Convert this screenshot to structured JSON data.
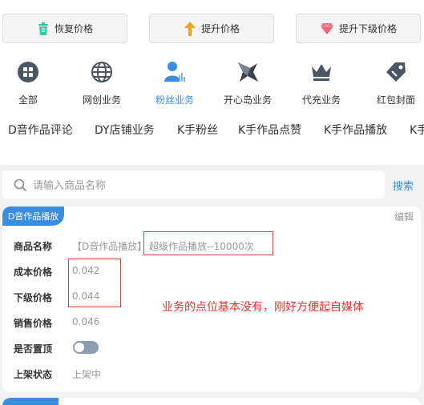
{
  "actions": [
    {
      "label": "恢复价格",
      "icon": "recycle-bin-icon"
    },
    {
      "label": "提升价格",
      "icon": "arrow-up-icon"
    },
    {
      "label": "提升下级价格",
      "icon": "diamond-icon"
    }
  ],
  "categories": [
    {
      "label": "全部",
      "icon": "grid-icon",
      "active": false
    },
    {
      "label": "网创业务",
      "icon": "globe-icon",
      "active": false
    },
    {
      "label": "粉丝业务",
      "icon": "user-chart-icon",
      "active": true
    },
    {
      "label": "开心岛业务",
      "icon": "star-icon",
      "active": false
    },
    {
      "label": "代充业务",
      "icon": "crown-icon",
      "active": false
    },
    {
      "label": "红包封面",
      "icon": "tag-icon",
      "active": false
    }
  ],
  "subtabs": [
    "D音作品评论",
    "DY店铺业务",
    "K手粉丝",
    "K手作品点赞",
    "K手作品播放",
    "K手"
  ],
  "search": {
    "placeholder": "请输入商品名称",
    "button": "搜索"
  },
  "card": {
    "badge": "D音作品播放",
    "edit": "编辑",
    "rows": [
      {
        "key": "商品名称",
        "value_prefix": "【D音作品播放】",
        "value_main": "超级作品播放--10000次"
      },
      {
        "key": "成本价格",
        "value": "0.042"
      },
      {
        "key": "下级价格",
        "value": "0.044"
      },
      {
        "key": "销售价格",
        "value": "0.046"
      },
      {
        "key": "是否置顶",
        "toggle": false
      },
      {
        "key": "上架状态",
        "value": "上架中"
      }
    ],
    "annotation": "业务的点位基本没有，刚好方便起自媒体"
  },
  "colors": {
    "accent": "#3a8ddf",
    "annotation": "#e8322e",
    "toggle_off": "#8e9cb0"
  }
}
